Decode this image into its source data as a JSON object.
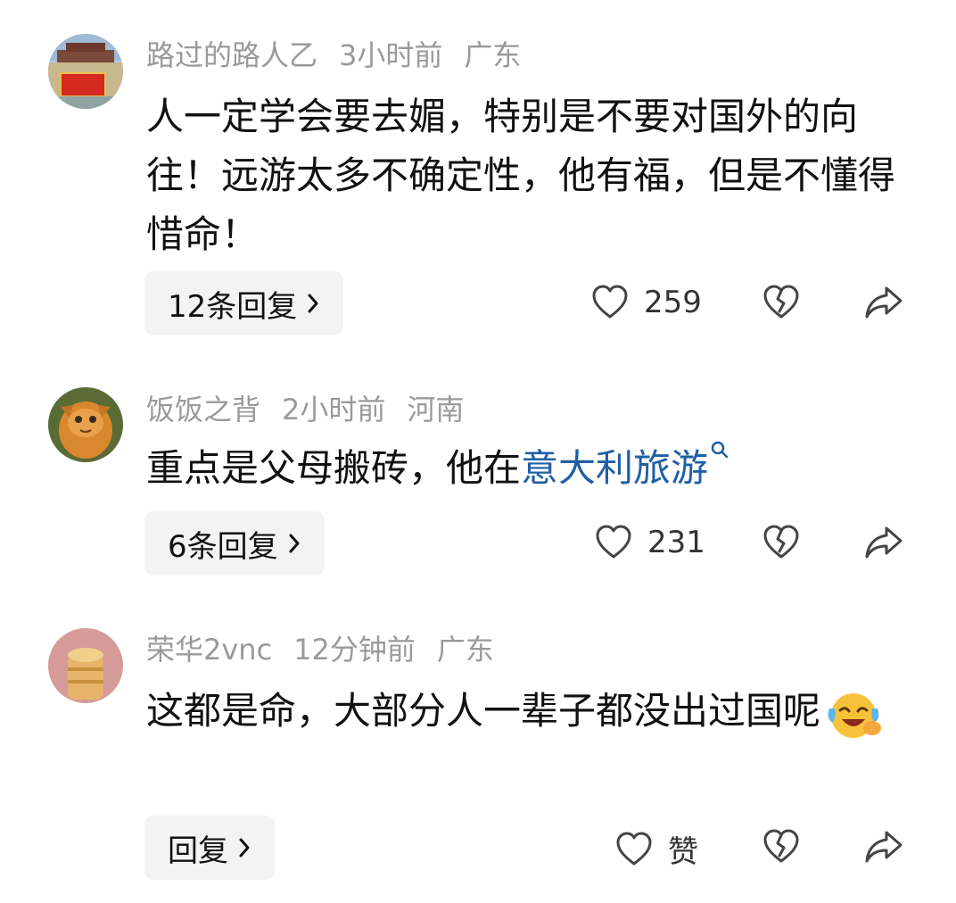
{
  "comments": [
    {
      "username": "路过的路人乙",
      "time": "3小时前",
      "location": "广东",
      "text": "人一定学会要去媚，特别是不要对国外的向往！远游太多不确定性，他有福，但是不懂得惜命！",
      "reply_label": "12条回复",
      "like_count": "259"
    },
    {
      "username": "饭饭之背",
      "time": "2小时前",
      "location": "河南",
      "text_before_link": "重点是父母搬砖，他在",
      "link_text": "意大利旅游",
      "reply_label": "6条回复",
      "like_count": "231"
    },
    {
      "username": "荣华2vnc",
      "time": "12分钟前",
      "location": "广东",
      "text": "这都是命，大部分人一辈子都没出过国呢",
      "reply_label": "回复",
      "like_label": "赞"
    }
  ],
  "icons": {
    "chevron": "chevron-right-icon",
    "like": "heart-icon",
    "dislike": "broken-heart-icon",
    "share": "share-arrow-icon",
    "search": "search-icon",
    "emoji": "laugh-cry-emoji-icon"
  },
  "colors": {
    "link": "#1f5fa5",
    "meta": "#9a9a9a",
    "text": "#111111",
    "button_bg": "#f3f3f3"
  }
}
